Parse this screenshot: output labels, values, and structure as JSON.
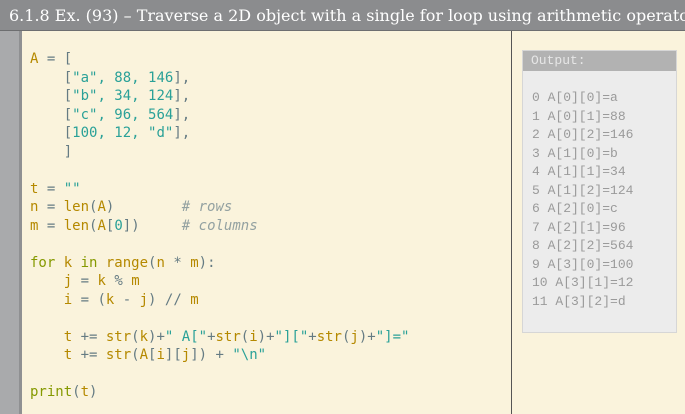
{
  "title": "6.1.8 Ex. (93) – Traverse a 2D object with a single for loop using arithmetic operators",
  "code_lines": [
    [
      [
        "A",
        "y"
      ],
      [
        " = [",
        "g"
      ]
    ],
    [
      [
        "    [",
        "g"
      ],
      [
        "\"a\", 88, 146",
        "c"
      ],
      [
        "],",
        "g"
      ]
    ],
    [
      [
        "    [",
        "g"
      ],
      [
        "\"b\", 34, 124",
        "c"
      ],
      [
        "],",
        "g"
      ]
    ],
    [
      [
        "    [",
        "g"
      ],
      [
        "\"c\", 96, 564",
        "c"
      ],
      [
        "],",
        "g"
      ]
    ],
    [
      [
        "    [",
        "g"
      ],
      [
        "100, 12, \"d\"",
        "c"
      ],
      [
        "],",
        "g"
      ]
    ],
    [
      [
        "    ]",
        "g"
      ]
    ],
    [],
    [
      [
        "t",
        "y"
      ],
      [
        " = ",
        "g"
      ],
      [
        "\"\"",
        "c"
      ]
    ],
    [
      [
        "n",
        "y"
      ],
      [
        " = ",
        "g"
      ],
      [
        "len",
        "y"
      ],
      [
        "(",
        "g"
      ],
      [
        "A",
        "y"
      ],
      [
        ")",
        "g"
      ],
      [
        "        # rows",
        "cm"
      ]
    ],
    [
      [
        "m",
        "y"
      ],
      [
        " = ",
        "g"
      ],
      [
        "len",
        "y"
      ],
      [
        "(",
        "g"
      ],
      [
        "A",
        "y"
      ],
      [
        "[",
        "g"
      ],
      [
        "0",
        "c"
      ],
      [
        "])",
        "g"
      ],
      [
        "     # columns",
        "cm"
      ]
    ],
    [],
    [
      [
        "for",
        "k"
      ],
      [
        " k ",
        "y"
      ],
      [
        "in",
        "k"
      ],
      [
        " range",
        "y"
      ],
      [
        "(",
        "g"
      ],
      [
        "n",
        "y"
      ],
      [
        " * ",
        "g"
      ],
      [
        "m",
        "y"
      ],
      [
        "):",
        "g"
      ]
    ],
    [
      [
        "    j",
        "y"
      ],
      [
        " = ",
        "g"
      ],
      [
        "k",
        "y"
      ],
      [
        " % ",
        "g"
      ],
      [
        "m",
        "y"
      ]
    ],
    [
      [
        "    i",
        "y"
      ],
      [
        " = (",
        "g"
      ],
      [
        "k",
        "y"
      ],
      [
        " - ",
        "g"
      ],
      [
        "j",
        "y"
      ],
      [
        ") // ",
        "g"
      ],
      [
        "m",
        "y"
      ]
    ],
    [],
    [
      [
        "    t",
        "y"
      ],
      [
        " += ",
        "g"
      ],
      [
        "str",
        "y"
      ],
      [
        "(",
        "g"
      ],
      [
        "k",
        "y"
      ],
      [
        ")+",
        "g"
      ],
      [
        "\" A[\"",
        "c"
      ],
      [
        "+",
        "g"
      ],
      [
        "str",
        "y"
      ],
      [
        "(",
        "g"
      ],
      [
        "i",
        "y"
      ],
      [
        ")+",
        "g"
      ],
      [
        "\"][\"",
        "c"
      ],
      [
        "+",
        "g"
      ],
      [
        "str",
        "y"
      ],
      [
        "(",
        "g"
      ],
      [
        "j",
        "y"
      ],
      [
        ")+",
        "g"
      ],
      [
        "\"]=\"",
        "c"
      ]
    ],
    [
      [
        "    t",
        "y"
      ],
      [
        " += ",
        "g"
      ],
      [
        "str",
        "y"
      ],
      [
        "(",
        "g"
      ],
      [
        "A",
        "y"
      ],
      [
        "[",
        "g"
      ],
      [
        "i",
        "y"
      ],
      [
        "][",
        "g"
      ],
      [
        "j",
        "y"
      ],
      [
        "]) + ",
        "g"
      ],
      [
        "\"\\n\"",
        "c"
      ]
    ],
    [],
    [
      [
        "print",
        "k"
      ],
      [
        "(",
        "g"
      ],
      [
        "t",
        "y"
      ],
      [
        ")",
        "g"
      ]
    ]
  ],
  "output": {
    "label": "Output:",
    "lines": [
      "0 A[0][0]=a",
      "1 A[0][1]=88",
      "2 A[0][2]=146",
      "3 A[1][0]=b",
      "4 A[1][1]=34",
      "5 A[1][2]=124",
      "6 A[2][0]=c",
      "7 A[2][1]=96",
      "8 A[2][2]=564",
      "9 A[3][0]=100",
      "10 A[3][1]=12",
      "11 A[3][2]=d"
    ]
  }
}
